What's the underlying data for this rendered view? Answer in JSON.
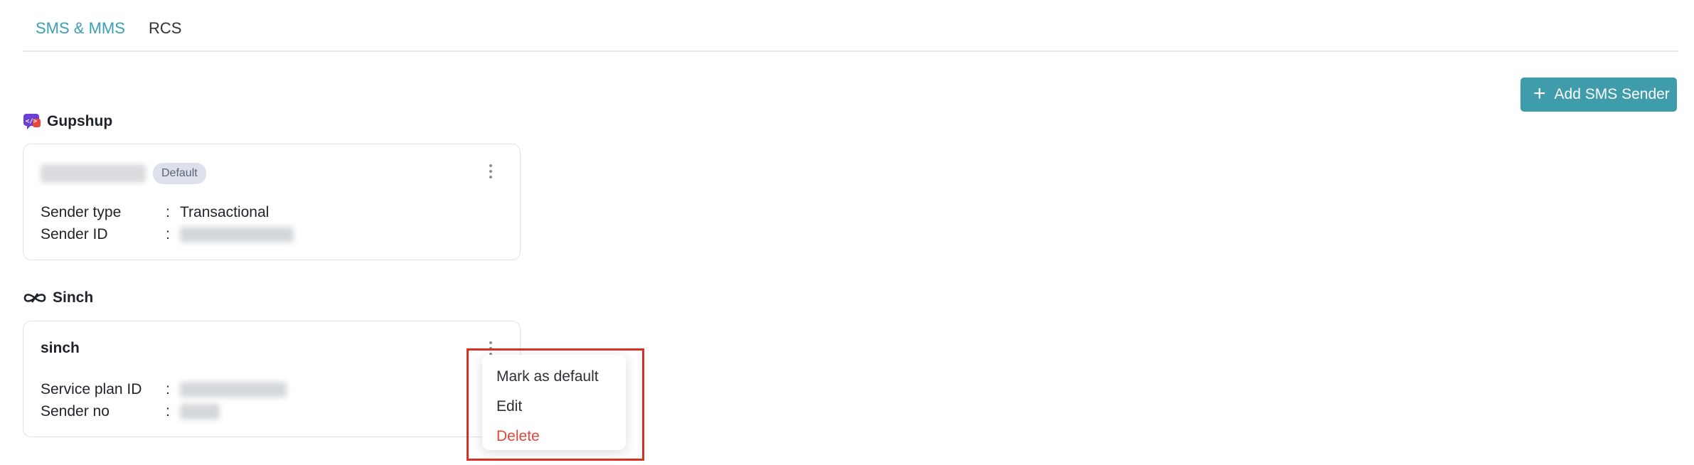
{
  "tabs": [
    {
      "label": "SMS & MMS",
      "active": true
    },
    {
      "label": "RCS",
      "active": false
    }
  ],
  "add_button": {
    "label": "Add SMS Sender",
    "icon": "plus-icon"
  },
  "providers": {
    "gupshup": {
      "name": "Gupshup",
      "card": {
        "badge": "Default",
        "rows": [
          {
            "key": "Sender type",
            "sep": ":",
            "value": "Transactional"
          },
          {
            "key": "Sender ID",
            "sep": ":"
          }
        ]
      }
    },
    "sinch": {
      "name": "Sinch",
      "card": {
        "title": "sinch",
        "rows": [
          {
            "key": "Service plan ID",
            "sep": ":"
          },
          {
            "key": "Sender no",
            "sep": ":"
          }
        ]
      }
    }
  },
  "menu": {
    "items": [
      {
        "label": "Mark as default"
      },
      {
        "label": "Edit"
      },
      {
        "label": "Delete"
      }
    ]
  },
  "colors": {
    "accent": "#3f9dab",
    "active_tab": "#3a9fb3",
    "danger": "#e0473a",
    "highlight": "#d93025"
  }
}
